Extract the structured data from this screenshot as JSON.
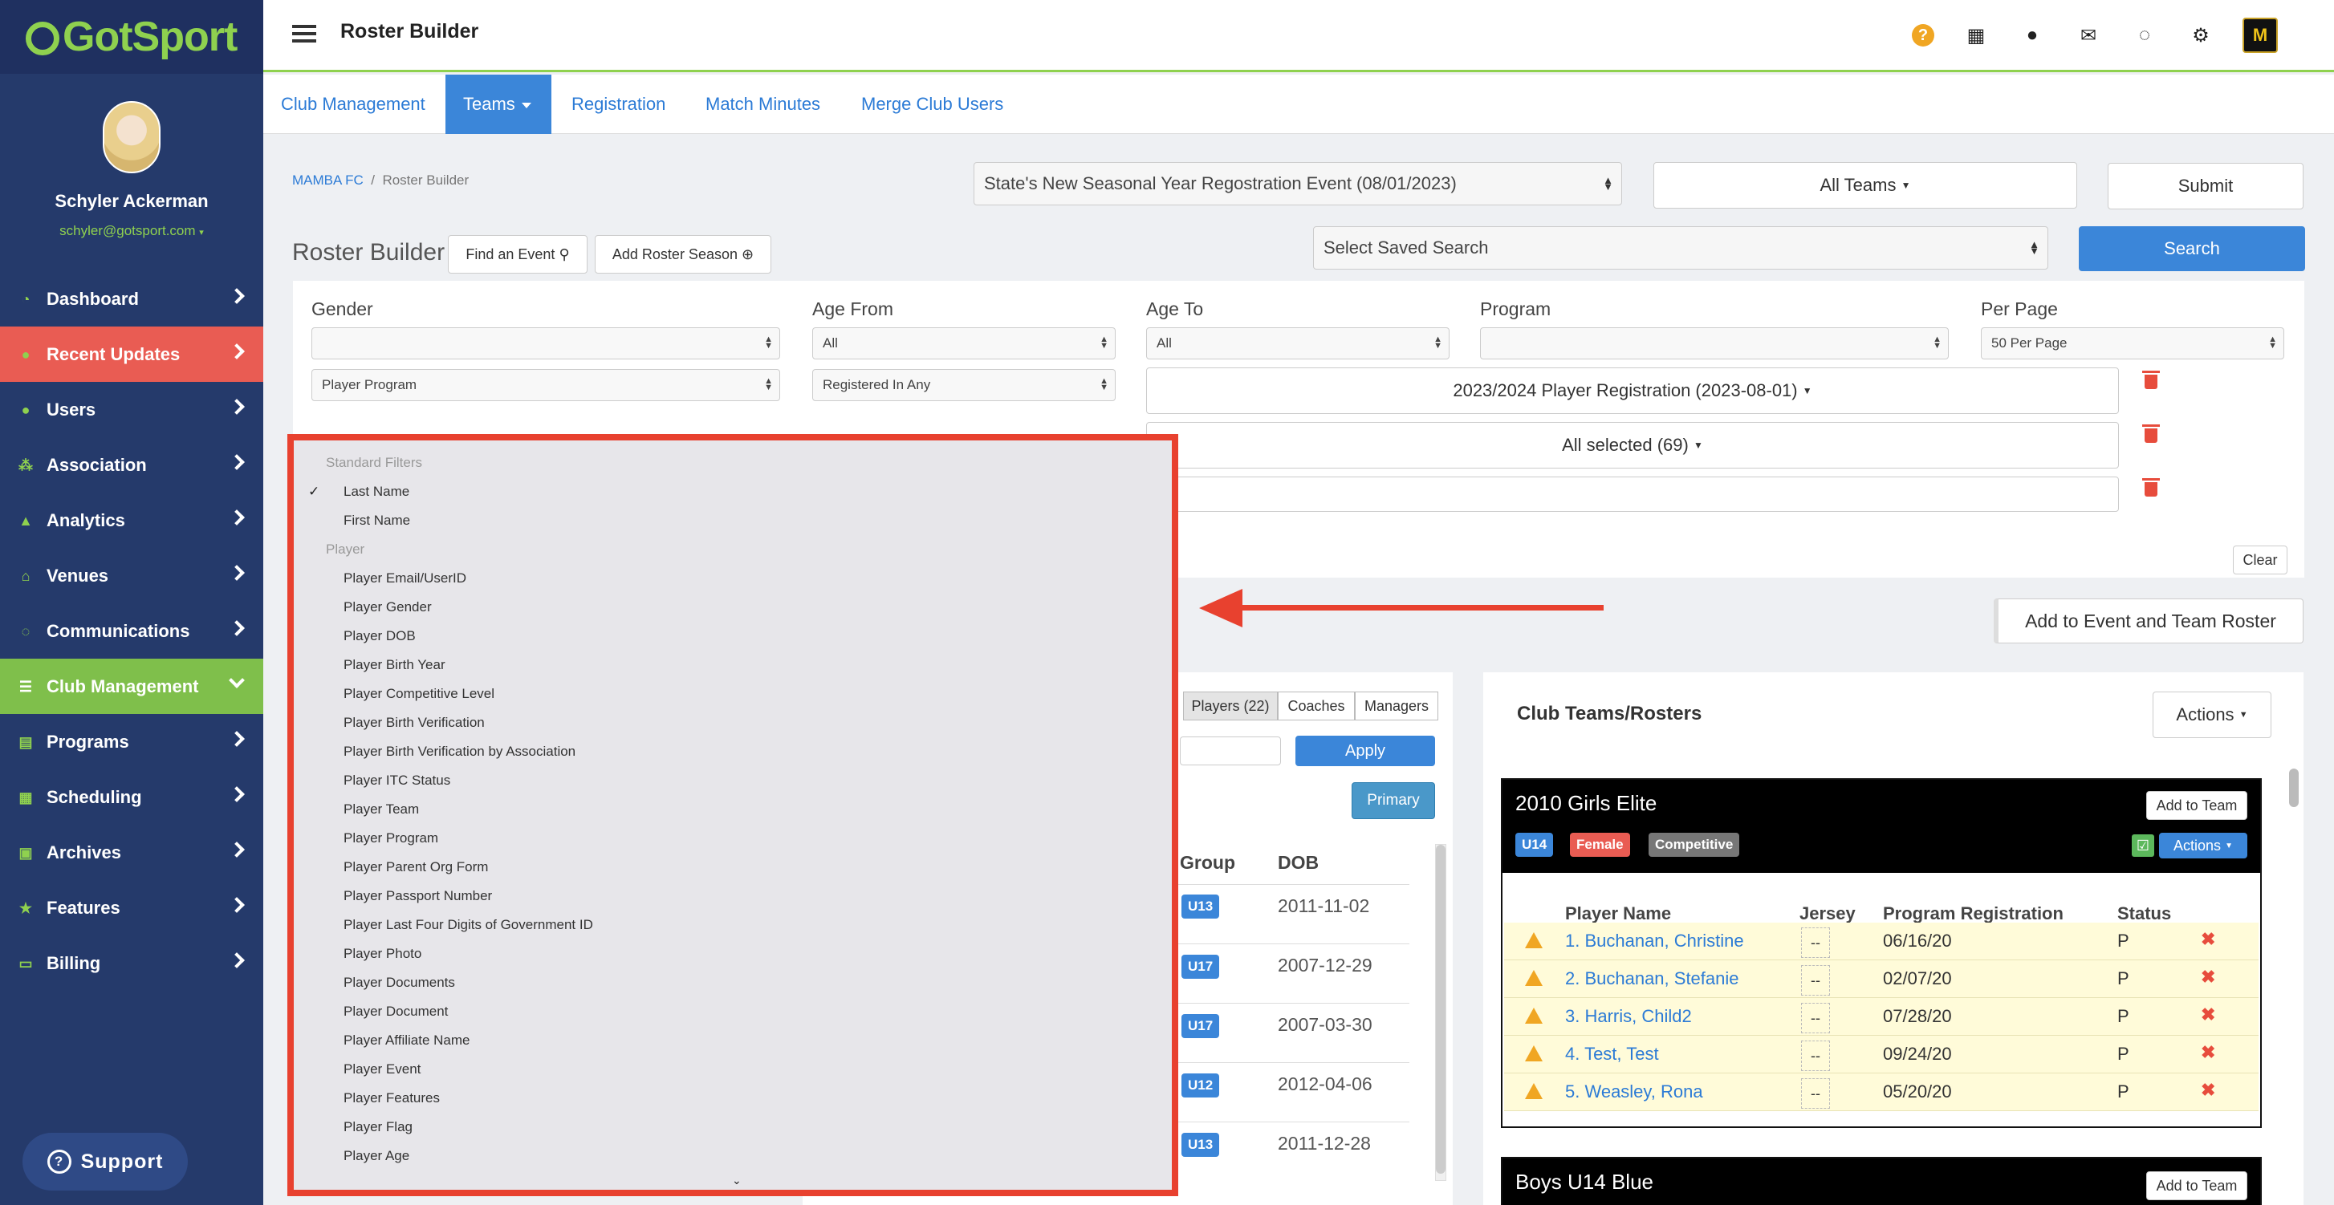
{
  "app": {
    "logo": "GotSport",
    "title": "Roster Builder"
  },
  "user": {
    "name": "Schyler Ackerman",
    "email": "schyler@gotsport.com"
  },
  "sidebar": {
    "items": [
      {
        "label": "Dashboard",
        "icon": "dashboard-icon"
      },
      {
        "label": "Recent Updates",
        "icon": "bell-icon"
      },
      {
        "label": "Users",
        "icon": "users-icon"
      },
      {
        "label": "Association",
        "icon": "sitemap-icon"
      },
      {
        "label": "Analytics",
        "icon": "chart-icon"
      },
      {
        "label": "Venues",
        "icon": "home-icon"
      },
      {
        "label": "Communications",
        "icon": "chat-icon"
      },
      {
        "label": "Club Management",
        "icon": "list-icon"
      },
      {
        "label": "Programs",
        "icon": "book-icon"
      },
      {
        "label": "Scheduling",
        "icon": "calendar-icon"
      },
      {
        "label": "Archives",
        "icon": "archive-icon"
      },
      {
        "label": "Features",
        "icon": "star-icon"
      },
      {
        "label": "Billing",
        "icon": "credit-card-icon"
      }
    ],
    "support": "Support"
  },
  "header": {
    "club_badge": "M"
  },
  "tabs": [
    {
      "label": "Club Management"
    },
    {
      "label": "Teams"
    },
    {
      "label": "Registration"
    },
    {
      "label": "Match Minutes"
    },
    {
      "label": "Merge Club Users"
    }
  ],
  "breadcrumb": {
    "root": "MAMBA FC",
    "separator": "/",
    "current": "Roster Builder"
  },
  "toolbar": {
    "event_select": "State's New Seasonal Year Regostration Event (08/01/2023)",
    "teams_select": "All Teams",
    "submit": "Submit",
    "saved_search": "Select Saved Search",
    "search": "Search",
    "find_event": "Find an Event",
    "add_roster_season": "Add Roster Season"
  },
  "page_title": "Roster Builder",
  "filters": {
    "labels": {
      "gender": "Gender",
      "age_from": "Age From",
      "age_to": "Age To",
      "program": "Program",
      "per_page": "Per Page"
    },
    "age_from": "All",
    "age_to": "All",
    "per_page": "50 Per Page",
    "row2_field": "Player Program",
    "row2_op": "Registered In Any",
    "row2_value": "2023/2024 Player Registration (2023-08-01)",
    "row3_value": "All selected (69)",
    "clear": "Clear"
  },
  "add_to_event": "Add to Event and Team Roster",
  "players_panel": {
    "tabs": [
      "Players (22)",
      "Coaches",
      "Managers"
    ],
    "apply": "Apply",
    "primary": "Primary",
    "headers": {
      "group": "Group",
      "dob": "DOB"
    },
    "rows": [
      {
        "group": "U13",
        "dob": "2011-11-02"
      },
      {
        "group": "U17",
        "dob": "2007-12-29"
      },
      {
        "group": "U17",
        "dob": "2007-03-30"
      },
      {
        "group": "U12",
        "dob": "2012-04-06"
      },
      {
        "group": "U13",
        "dob": "2011-12-28"
      }
    ]
  },
  "club_teams": {
    "title": "Club Teams/Rosters",
    "actions": "Actions",
    "team1": {
      "name": "2010 Girls Elite",
      "add": "Add to Team",
      "badges": [
        "U14",
        "Female",
        "Competitive"
      ],
      "actions": "Actions",
      "columns": {
        "name": "Player Name",
        "jersey": "Jersey",
        "reg": "Program Registration",
        "status": "Status"
      },
      "players": [
        {
          "name": "1. Buchanan, Christine",
          "jersey": "--",
          "reg": "06/16/20",
          "status": "P"
        },
        {
          "name": "2. Buchanan, Stefanie",
          "jersey": "--",
          "reg": "02/07/20",
          "status": "P"
        },
        {
          "name": "3. Harris, Child2",
          "jersey": "--",
          "reg": "07/28/20",
          "status": "P"
        },
        {
          "name": "4. Test, Test",
          "jersey": "--",
          "reg": "09/24/20",
          "status": "P"
        },
        {
          "name": "5. Weasley, Rona",
          "jersey": "--",
          "reg": "05/20/20",
          "status": "P"
        }
      ]
    },
    "team2": {
      "name": "Boys U14 Blue",
      "add": "Add to Team"
    }
  },
  "dropdown": {
    "group1": "Standard Filters",
    "standard": [
      "Last Name",
      "First Name"
    ],
    "group2": "Player",
    "player": [
      "Player Email/UserID",
      "Player Gender",
      "Player DOB",
      "Player Birth Year",
      "Player Competitive Level",
      "Player Birth Verification",
      "Player Birth Verification by Association",
      "Player ITC Status",
      "Player Team",
      "Player Program",
      "Player Parent Org Form",
      "Player Passport Number",
      "Player Last Four Digits of Government ID",
      "Player Photo",
      "Player Documents",
      "Player Document",
      "Player Affiliate Name",
      "Player Event",
      "Player Features",
      "Player Flag",
      "Player Age"
    ]
  },
  "colors": {
    "sidebar": "#253a6b",
    "accent_green": "#8fd14f",
    "recent_updates": "#e95c53",
    "primary_blue": "#3b86d9",
    "highlight_red": "#e8412f"
  }
}
